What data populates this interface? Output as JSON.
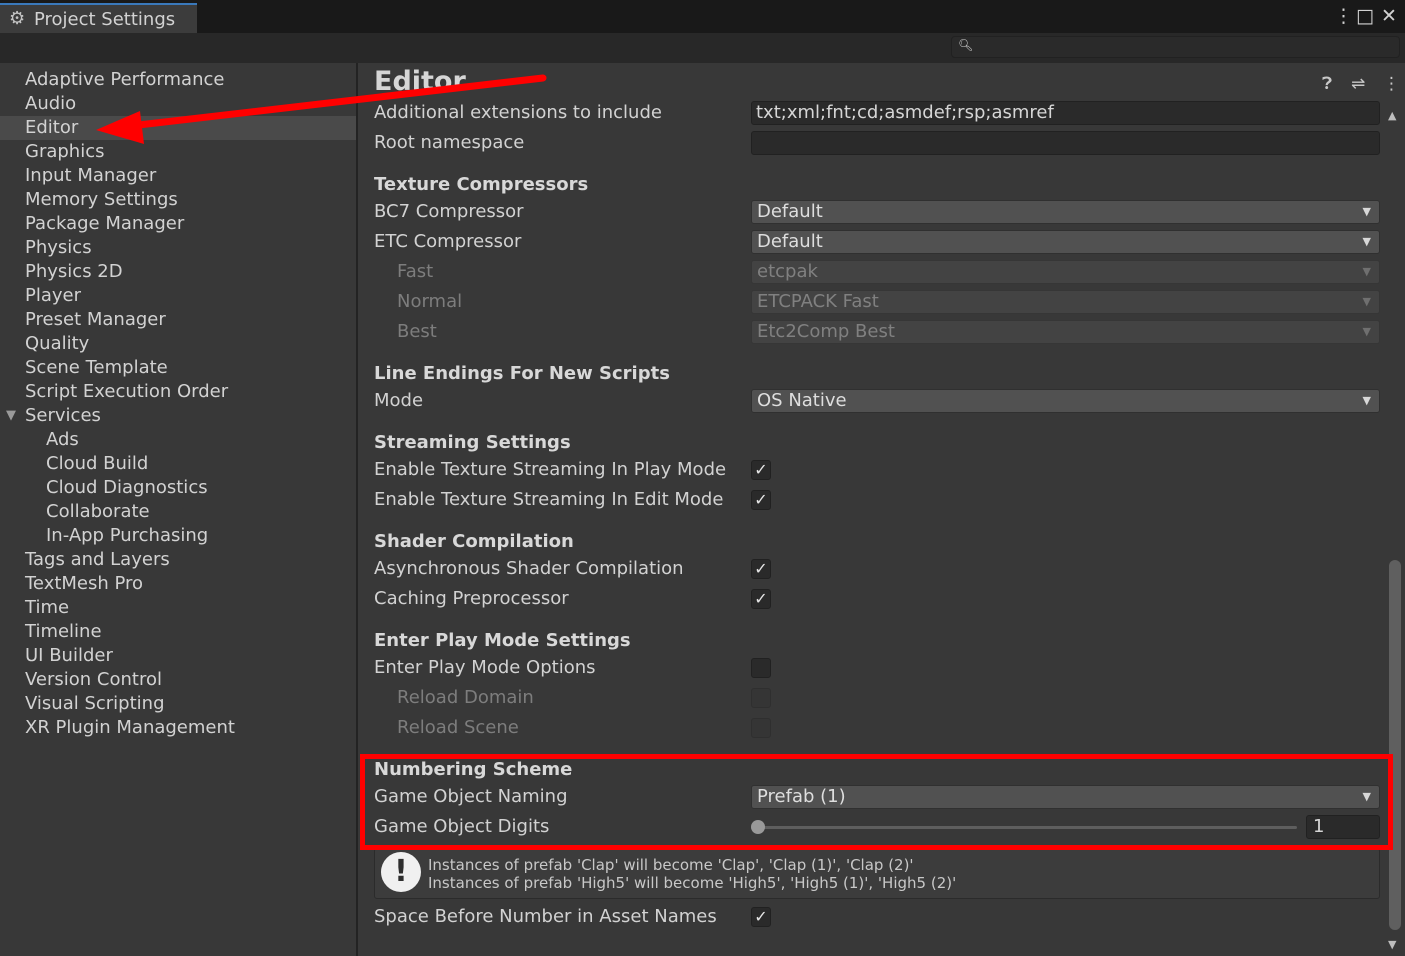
{
  "window": {
    "title": "Project Settings",
    "icons": [
      "gear-icon",
      "kebab-menu-icon",
      "maximize-icon",
      "close-icon"
    ]
  },
  "search": {
    "placeholder": ""
  },
  "sidebar": {
    "items": [
      {
        "label": "Adaptive Performance"
      },
      {
        "label": "Audio"
      },
      {
        "label": "Editor",
        "selected": true
      },
      {
        "label": "Graphics"
      },
      {
        "label": "Input Manager"
      },
      {
        "label": "Memory Settings"
      },
      {
        "label": "Package Manager"
      },
      {
        "label": "Physics"
      },
      {
        "label": "Physics 2D"
      },
      {
        "label": "Player"
      },
      {
        "label": "Preset Manager"
      },
      {
        "label": "Quality"
      },
      {
        "label": "Scene Template"
      },
      {
        "label": "Script Execution Order"
      },
      {
        "label": "Services",
        "expanded": true
      },
      {
        "label": "Ads"
      },
      {
        "label": "Cloud Build"
      },
      {
        "label": "Cloud Diagnostics"
      },
      {
        "label": "Collaborate"
      },
      {
        "label": "In-App Purchasing"
      },
      {
        "label": "Tags and Layers"
      },
      {
        "label": "TextMesh Pro"
      },
      {
        "label": "Time"
      },
      {
        "label": "Timeline"
      },
      {
        "label": "UI Builder"
      },
      {
        "label": "Version Control"
      },
      {
        "label": "Visual Scripting"
      },
      {
        "label": "XR Plugin Management"
      }
    ]
  },
  "main": {
    "title": "Editor",
    "header_icons": [
      "help-icon",
      "preset-icon",
      "kebab-menu-icon"
    ],
    "additional_extensions": {
      "label": "Additional extensions to include",
      "value": "txt;xml;fnt;cd;asmdef;rsp;asmref"
    },
    "root_namespace": {
      "label": "Root namespace",
      "value": ""
    },
    "texture_compressors": {
      "heading": "Texture Compressors",
      "bc7": {
        "label": "BC7 Compressor",
        "value": "Default"
      },
      "etc": {
        "label": "ETC Compressor",
        "value": "Default"
      },
      "fast": {
        "label": "Fast",
        "value": "etcpak"
      },
      "normal": {
        "label": "Normal",
        "value": "ETCPACK Fast"
      },
      "best": {
        "label": "Best",
        "value": "Etc2Comp Best"
      }
    },
    "line_endings": {
      "heading": "Line Endings For New Scripts",
      "mode_label": "Mode",
      "mode_value": "OS Native"
    },
    "streaming": {
      "heading": "Streaming Settings",
      "play_mode": {
        "label": "Enable Texture Streaming In Play Mode",
        "checked": true
      },
      "edit_mode": {
        "label": "Enable Texture Streaming In Edit Mode",
        "checked": true
      }
    },
    "shader": {
      "heading": "Shader Compilation",
      "async": {
        "label": "Asynchronous Shader Compilation",
        "checked": true
      },
      "caching": {
        "label": "Caching Preprocessor",
        "checked": true
      }
    },
    "play_mode": {
      "heading": "Enter Play Mode Settings",
      "options": {
        "label": "Enter Play Mode Options",
        "checked": false
      },
      "reload_domain": {
        "label": "Reload Domain",
        "checked": false
      },
      "reload_scene": {
        "label": "Reload Scene",
        "checked": false
      }
    },
    "numbering": {
      "heading": "Numbering Scheme",
      "naming": {
        "label": "Game Object Naming",
        "value": "Prefab (1)"
      },
      "digits": {
        "label": "Game Object Digits",
        "value": "1",
        "slider_min": 1,
        "slider_max": 5
      },
      "help": [
        "Instances of prefab 'Clap' will become 'Clap', 'Clap (1)', 'Clap (2)'",
        "Instances of prefab 'High5' will become 'High5', 'High5 (1)', 'High5 (2)'"
      ]
    },
    "space_before_number": {
      "label": "Space Before Number in Asset Names",
      "checked": true
    }
  },
  "annotation_colors": {
    "arrow": "#ff0000",
    "highlight_box": "#ff0000"
  }
}
